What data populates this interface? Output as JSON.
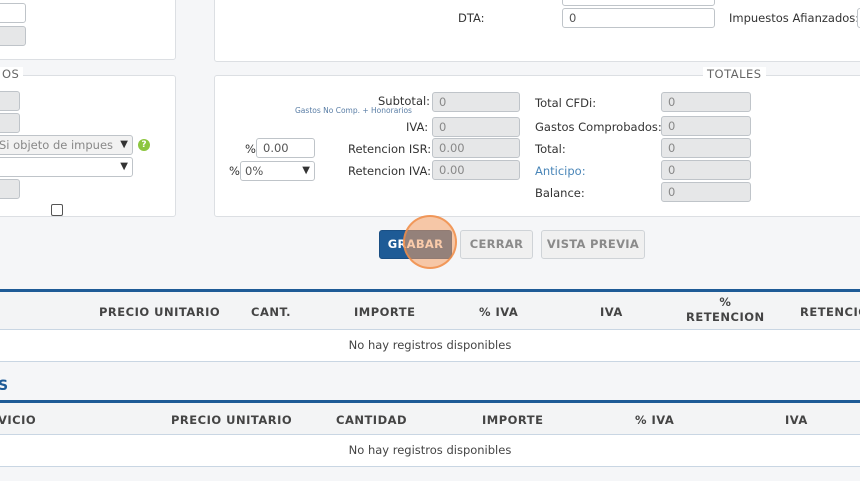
{
  "top_right": {
    "dta_label": "DTA:",
    "dta_value": "0",
    "impuestos_afianzados_label": "Impuestos Afianzados:"
  },
  "left_panel": {
    "legend": "OS",
    "select_objeto": "Si objeto de impues",
    "info_icon": "?"
  },
  "totals_panel": {
    "legend": "TOTALES",
    "subtotal_label": "Subtotal:",
    "subtotal_note": "Gastos No Comp. + Honorarios",
    "subtotal_value": "0",
    "iva_label": "IVA:",
    "iva_value": "0",
    "ret_isr_pct_prefix": "%",
    "ret_isr_pct": "0.00",
    "ret_isr_label": "Retencion ISR:",
    "ret_isr_value": "0.00",
    "ret_iva_pct_prefix": "%",
    "ret_iva_pct": "0%",
    "ret_iva_label": "Retencion IVA:",
    "ret_iva_value": "0.00",
    "total_cfdi_label": "Total CFDi:",
    "total_cfdi_value": "0",
    "gastos_comprobados_label": "Gastos Comprobados:",
    "gastos_comprobados_value": "0",
    "total_label": "Total:",
    "total_value": "0",
    "anticipo_label": "Anticipo:",
    "anticipo_value": "0",
    "balance_label": "Balance:",
    "balance_value": "0"
  },
  "actions": {
    "grabar": "GRABAR",
    "cerrar": "CERRAR",
    "vista_previa": "VISTA PREVIA"
  },
  "grid1": {
    "columns": [
      "PRECIO UNITARIO",
      "CANT.",
      "IMPORTE",
      "% IVA",
      "IVA",
      "%\nRETENCION",
      "RETENCIO"
    ],
    "empty": "No hay registros disponibles"
  },
  "section2_title": "S",
  "grid2": {
    "columns": [
      "VICIO",
      "PRECIO UNITARIO",
      "CANTIDAD",
      "IMPORTE",
      "% IVA",
      "IVA"
    ],
    "empty": "No hay registros disponibles"
  },
  "colors": {
    "primary": "#1e5b96",
    "readonly": "#e6e7e8",
    "link": "#4a86b8",
    "info": "#8cc63f"
  }
}
